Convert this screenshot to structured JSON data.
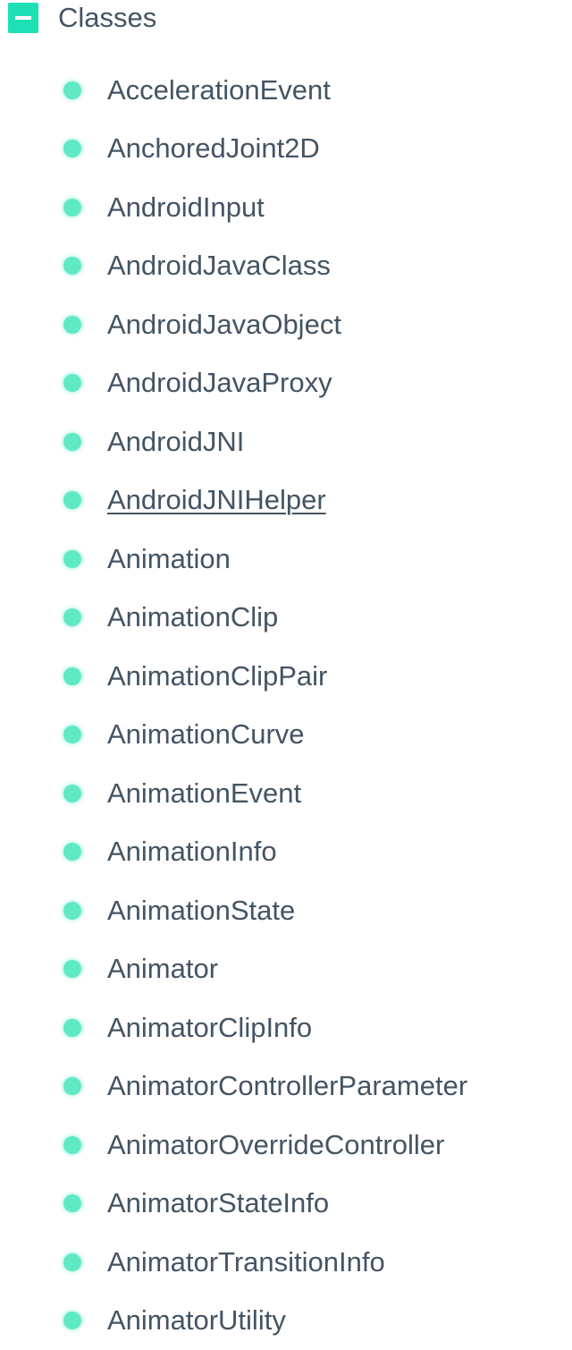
{
  "section": {
    "title": "Classes",
    "toggle_icon": "minus-icon",
    "accent_color": "#1fe0b5"
  },
  "bullet_color": "#5fe9c5",
  "text_color": "#455463",
  "classes": [
    {
      "label": "AccelerationEvent"
    },
    {
      "label": "AnchoredJoint2D"
    },
    {
      "label": "AndroidInput"
    },
    {
      "label": "AndroidJavaClass"
    },
    {
      "label": "AndroidJavaObject"
    },
    {
      "label": "AndroidJavaProxy"
    },
    {
      "label": "AndroidJNI"
    },
    {
      "label": "AndroidJNIHelper",
      "hovered": true
    },
    {
      "label": "Animation"
    },
    {
      "label": "AnimationClip"
    },
    {
      "label": "AnimationClipPair"
    },
    {
      "label": "AnimationCurve"
    },
    {
      "label": "AnimationEvent"
    },
    {
      "label": "AnimationInfo"
    },
    {
      "label": "AnimationState"
    },
    {
      "label": "Animator"
    },
    {
      "label": "AnimatorClipInfo"
    },
    {
      "label": "AnimatorControllerParameter"
    },
    {
      "label": "AnimatorOverrideController"
    },
    {
      "label": "AnimatorStateInfo"
    },
    {
      "label": "AnimatorTransitionInfo"
    },
    {
      "label": "AnimatorUtility"
    }
  ]
}
